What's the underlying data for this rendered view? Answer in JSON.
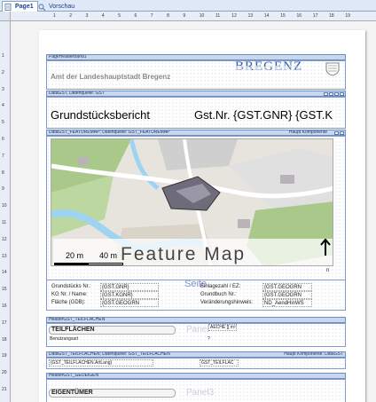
{
  "tabs": [
    {
      "label": "Page1",
      "active": true
    },
    {
      "label": "Vorschau",
      "active": false
    }
  ],
  "ruler_h": [
    "1",
    "2",
    "3",
    "4",
    "5",
    "6",
    "7",
    "8",
    "9",
    "10",
    "11",
    "12",
    "13",
    "14",
    "15",
    "16",
    "17",
    "18",
    "19"
  ],
  "ruler_v": [
    "1",
    "2",
    "3",
    "4",
    "5",
    "6",
    "7",
    "8",
    "9",
    "10",
    "11",
    "12",
    "13",
    "14",
    "15",
    "16",
    "17",
    "18",
    "19",
    "20",
    "21"
  ],
  "page_header": {
    "band_label": "PageHeaderBand1",
    "org_text": "Amt der Landeshauptstadt Bregenz",
    "brand": "BREGENZ",
    "brand_color": "#2f5fa8"
  },
  "data_gst": {
    "band_label": "DataGST, Datenquelle: GST",
    "title": "Grundstücksbericht",
    "gst_nr": "Gst.Nr. {GST.GNR} {GST.K"
  },
  "featuremap_band": {
    "band_label": "DataGST_FEATUREMAP; Datenquelle: GST_FEATUREMAP",
    "right_label": "Haupt Komponente",
    "map_caption": "Feature Map",
    "scale_20": "20 m",
    "scale_40": "40 m",
    "north": "n"
  },
  "details": {
    "left_labels": [
      "Grundstücks Nr.:",
      "KG Nr. / Name:",
      "Fläche (GDB):"
    ],
    "left_values": [
      "{GST.GNR}",
      "{GST.KGNR}",
      "{GST.GEOGRN"
    ],
    "ghost": "Seite",
    "right_labels": [
      "Einlagezahl / EZ:",
      "Grundbuch Nr.:",
      "Veränderungshinweis:"
    ],
    "right_values": [
      "{GST.GEOGRN",
      "{GST.GEOGRN",
      "ND_AendHinWS"
    ]
  },
  "header_teilflaechen": {
    "band_label": "HeaderGST_TEILFLÄCHEN",
    "title": "TEILFLÄCHEN",
    "ghost": "Panel",
    "area_label": "AECHE [] m²",
    "col_label": "Benutzungsart",
    "q": "?"
  },
  "data_teilflaechen": {
    "band_label": "DataGST_TEILFLÄCHEN; Datenquelle: GST_TEILFLÄCHEN",
    "right_label": "Haupt Komponente: DataGST",
    "field1": "{GST_TEILFLÄCHEN.ArtLang}",
    "field2": "GST_TEILFLÄC"
  },
  "header_geoeigen": {
    "band_label": "HeaderGST_GEOEIGEN",
    "title": "EIGENTÜMER",
    "ghost": "Panel3"
  }
}
